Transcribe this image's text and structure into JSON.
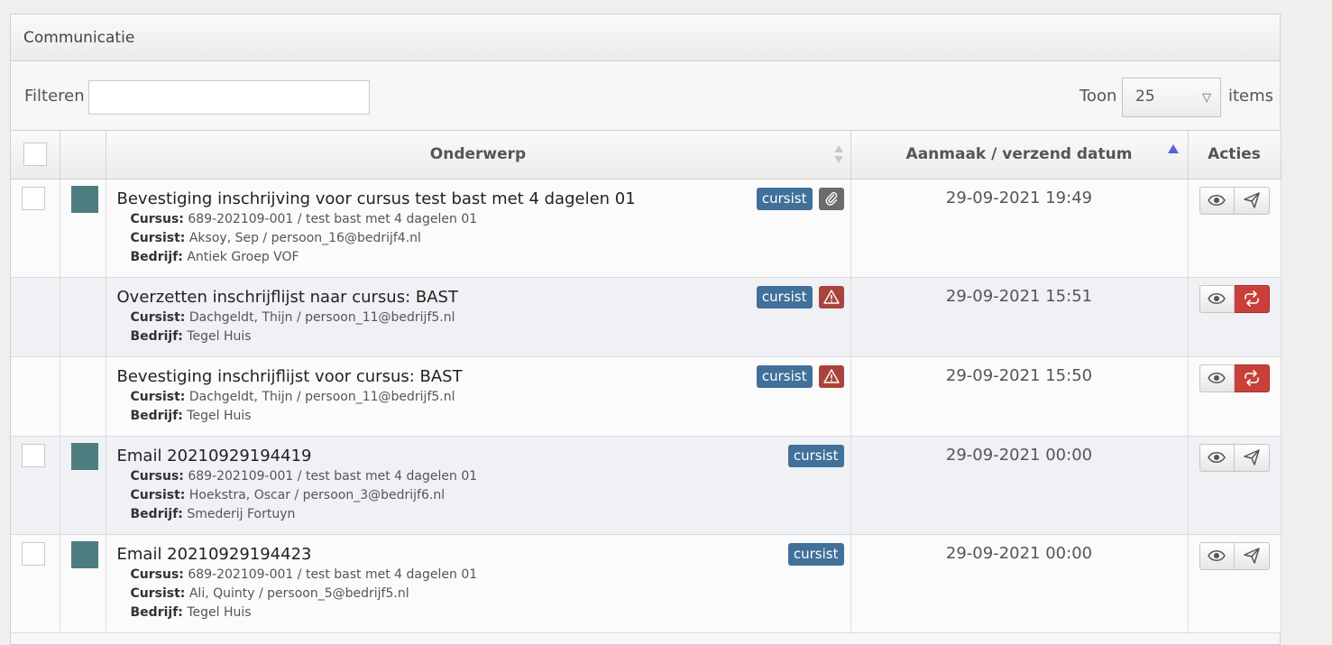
{
  "panel": {
    "title": "Communicatie"
  },
  "toolbar": {
    "filter_label": "Filteren",
    "filter_value": "",
    "show_label": "Toon",
    "page_size": "25",
    "items_label": "items"
  },
  "table": {
    "headers": {
      "subject": "Onderwerp",
      "date": "Aanmaak / verzend datum",
      "actions": "Acties"
    },
    "labels": {
      "course": "Cursus:",
      "student": "Cursist:",
      "company": "Bedrijf:"
    },
    "rows": [
      {
        "title": "Bevestiging inschrijving voor cursus test bast met 4 dagelen 01",
        "course": "689-202109-001 / test bast met 4 dagelen 01",
        "student": "Aksoy, Sep / persoon_16@bedrijf4.nl",
        "company": "Antiek Groep VOF",
        "badge": "cursist",
        "date": "29-09-2021 19:49",
        "extra_icon": "paperclip-icon",
        "secondary_action": "send-icon"
      },
      {
        "title": "Overzetten inschrijflijst naar cursus: BAST",
        "student": "Dachgeldt, Thijn / persoon_11@bedrijf5.nl",
        "company": "Tegel Huis",
        "badge": "cursist",
        "date": "29-09-2021 15:51",
        "extra_icon": "warning-icon",
        "secondary_action": "retry-icon"
      },
      {
        "title": "Bevestiging inschrijflijst voor cursus: BAST",
        "student": "Dachgeldt, Thijn / persoon_11@bedrijf5.nl",
        "company": "Tegel Huis",
        "badge": "cursist",
        "date": "29-09-2021 15:50",
        "extra_icon": "warning-icon",
        "secondary_action": "retry-icon"
      },
      {
        "title": "Email 20210929194419",
        "course": "689-202109-001 / test bast met 4 dagelen 01",
        "student": "Hoekstra, Oscar / persoon_3@bedrijf6.nl",
        "company": "Smederij Fortuyn",
        "badge": "cursist",
        "date": "29-09-2021 00:00",
        "secondary_action": "send-icon"
      },
      {
        "title": "Email 20210929194423",
        "course": "689-202109-001 / test bast met 4 dagelen 01",
        "student": "Ali, Quinty / persoon_5@bedrijf5.nl",
        "company": "Tegel Huis",
        "badge": "cursist",
        "date": "29-09-2021 00:00",
        "secondary_action": "send-icon"
      }
    ]
  },
  "colors": {
    "badge": "#41709a",
    "status_square": "#4e7d80",
    "danger": "#c9403a",
    "warning_tag": "#a9443c",
    "attach_tag": "#6b6b6b",
    "sort_active": "#5a62d8"
  }
}
